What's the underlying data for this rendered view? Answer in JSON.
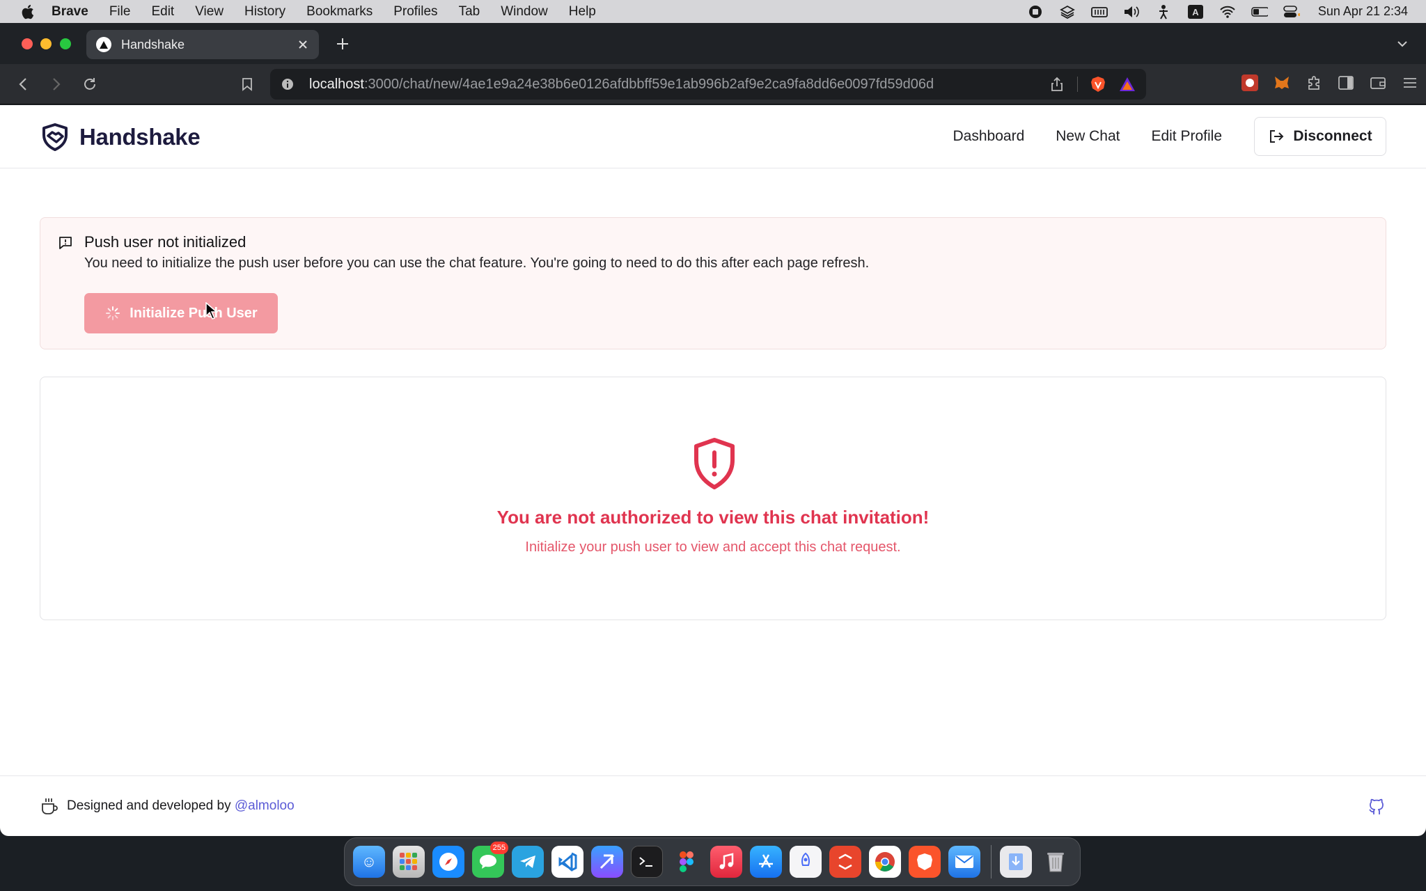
{
  "menubar": {
    "app_name": "Brave",
    "items": [
      "File",
      "Edit",
      "View",
      "History",
      "Bookmarks",
      "Profiles",
      "Tab",
      "Window",
      "Help"
    ],
    "clock": "Sun Apr 21  2:34"
  },
  "browser": {
    "tab_title": "Handshake",
    "url_host": "localhost",
    "url_rest": ":3000/chat/new/4ae1e9a24e38b6e0126afdbbff59e1ab996b2af9e2ca9fa8dd6e0097fd59d06d"
  },
  "site": {
    "brand": "Handshake",
    "nav": {
      "dashboard": "Dashboard",
      "new_chat": "New Chat",
      "edit_profile": "Edit Profile",
      "disconnect": "Disconnect"
    }
  },
  "alert": {
    "title": "Push user not initialized",
    "description": "You need to initialize the push user before you can use the chat feature. You're going to need to do this after each page refresh.",
    "button_label": "Initialize Push User"
  },
  "auth_card": {
    "title": "You are not authorized to view this chat invitation!",
    "subtitle": "Initialize your push user to view and accept this chat request."
  },
  "footer": {
    "credit_prefix": "Designed and developed by ",
    "author": "@almoloo"
  },
  "dock": {
    "messages_badge": "255"
  },
  "colors": {
    "brand_navy": "#1d1b3e",
    "danger": "#e0344f",
    "danger_light": "#f39aa1",
    "link": "#5b5bd6"
  }
}
